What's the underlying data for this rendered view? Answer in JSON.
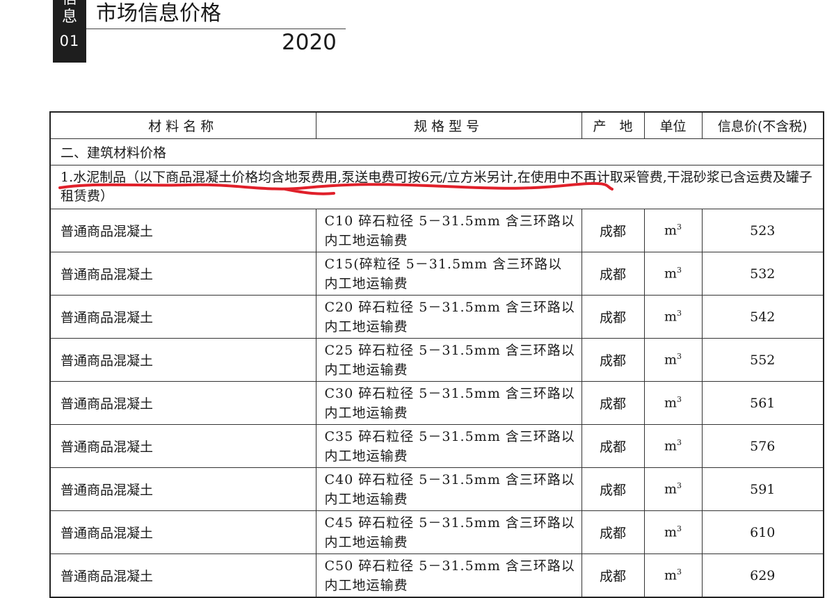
{
  "header": {
    "badge_top": "信",
    "badge_mid": "息",
    "badge_num": "01",
    "title": "市场信息价格",
    "year": "2020"
  },
  "table": {
    "headers": {
      "name": "材料名称",
      "spec": "规格型号",
      "origin": "产　地",
      "unit": "单位",
      "price": "信息价(不含税)"
    },
    "section_title": "二、建筑材料价格",
    "note": "1.水泥制品（以下商品混凝土价格均含地泵费用,泵送电费可按6元/立方米另计,在使用中不再计取采管费,干混砂浆已含运费及罐子租赁费）",
    "rows": [
      {
        "name": "普通商品混凝土",
        "spec": "C10 碎石粒径 5－31.5mm 含三环路以内工地运输费",
        "origin": "成都",
        "unit": "m",
        "unit_sup": "3",
        "price": "523"
      },
      {
        "name": "普通商品混凝土",
        "spec": "C15(碎粒径 5－31.5mm 含三环路以内工地运输费",
        "origin": "成都",
        "unit": "m",
        "unit_sup": "3",
        "price": "532"
      },
      {
        "name": "普通商品混凝土",
        "spec": "C20 碎石粒径 5－31.5mm 含三环路以内工地运输费",
        "origin": "成都",
        "unit": "m",
        "unit_sup": "3",
        "price": "542"
      },
      {
        "name": "普通商品混凝土",
        "spec": "C25 碎石粒径 5－31.5mm 含三环路以内工地运输费",
        "origin": "成都",
        "unit": "m",
        "unit_sup": "3",
        "price": "552"
      },
      {
        "name": "普通商品混凝土",
        "spec": "C30 碎石粒径 5－31.5mm 含三环路以内工地运输费",
        "origin": "成都",
        "unit": "m",
        "unit_sup": "3",
        "price": "561"
      },
      {
        "name": "普通商品混凝土",
        "spec": "C35 碎石粒径 5－31.5mm 含三环路以内工地运输费",
        "origin": "成都",
        "unit": "m",
        "unit_sup": "3",
        "price": "576"
      },
      {
        "name": "普通商品混凝土",
        "spec": "C40 碎石粒径 5－31.5mm 含三环路以内工地运输费",
        "origin": "成都",
        "unit": "m",
        "unit_sup": "3",
        "price": "591"
      },
      {
        "name": "普通商品混凝土",
        "spec": "C45 碎石粒径 5－31.5mm 含三环路以内工地运输费",
        "origin": "成都",
        "unit": "m",
        "unit_sup": "3",
        "price": "610"
      },
      {
        "name": "普通商品混凝土",
        "spec": "C50 碎石粒径 5－31.5mm 含三环路以内工地运输费",
        "origin": "成都",
        "unit": "m",
        "unit_sup": "3",
        "price": "629"
      }
    ]
  },
  "colors": {
    "annotation_red": "#e0202a",
    "badge_bg": "#1e1e1e"
  }
}
